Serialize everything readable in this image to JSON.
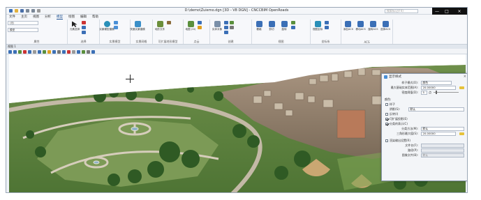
{
  "window": {
    "title": "D:\\demo\\Zuiemo.dgn [3D - V8 DGN] - CNCCBIM OpenRoads",
    "search_placeholder": "搜索标记(F4)",
    "min_label": "—",
    "max_label": "□",
    "close_label": "×"
  },
  "menu": [
    "文件",
    "主页",
    "视图",
    "分析",
    "模型",
    "绘图",
    "编辑",
    "帮助"
  ],
  "ribbon": {
    "dropdown_1": "(无)",
    "dropdown_2": "模型",
    "groups": [
      {
        "label": "属性",
        "buttons": []
      },
      {
        "label": "选择",
        "buttons": [
          "元素选择"
        ]
      },
      {
        "label": "实景模型",
        "buttons": [
          "实景模型建模"
        ]
      },
      {
        "label": "实景网格",
        "buttons": [
          "快速实景建模"
        ]
      },
      {
        "label": "可扩展地形模型",
        "buttons": [
          "地形文件"
        ]
      },
      {
        "label": "点云",
        "buttons": [
          "地图 (Gi)"
        ]
      },
      {
        "label": "创建",
        "buttons": [
          "实体对象"
        ]
      },
      {
        "label": "视图",
        "buttons": [
          "栅格",
          "剪切",
          "旋转"
        ]
      },
      {
        "label": "坐标系",
        "buttons": [
          "视图坐标"
        ]
      },
      {
        "label": "ACS",
        "buttons": [
          "添加ACS",
          "移动ACS",
          "旋转ACS",
          "选择ACS"
        ]
      }
    ]
  },
  "view": {
    "header": "视图 1",
    "tool_colors": [
      "#3b6fb6",
      "#3b6fb6",
      "#5a8f3c",
      "#c33",
      "#3b6fb6",
      "#999",
      "#3b6fb6",
      "#5a8f3c",
      "#e0a020",
      "#3b6fb6",
      "#777",
      "#3b6fb6",
      "#c33",
      "#999",
      "#3b6fb6",
      "#5a8f3c",
      "#777",
      "#3b6fb6"
    ]
  },
  "dialog": {
    "title": "显示样式",
    "close_label": "×",
    "fields": {
      "mode_label": "样子模式(O):",
      "mode_value": "颜色",
      "max_dist_label": "最大基础实体范围(A):",
      "max_dist_value": "20.00000",
      "density_label": "密度阈值(D):",
      "density_value": "5",
      "density_unit": "点",
      "section_label": "颜色:",
      "sample_label": "样子",
      "shade_label": "阴影(S):",
      "shade_value": "默认",
      "invert_label": "反转(I)",
      "visible_label": "可扩展投影(E)",
      "classify_label": "分类的表示(C)",
      "classify_mode_label": "分类方法(M):",
      "classify_mode_value": "默认",
      "classify_dist_label": "三角形最大值(S):",
      "classify_dist_value": "20.00000",
      "output_label": "渲染输出设置(R)",
      "file_label": "文件名(F):",
      "file_value": "",
      "path_label": "路径(P):",
      "path_value": "",
      "format_label": "图像文件(B):",
      "format_value": "默认"
    }
  }
}
